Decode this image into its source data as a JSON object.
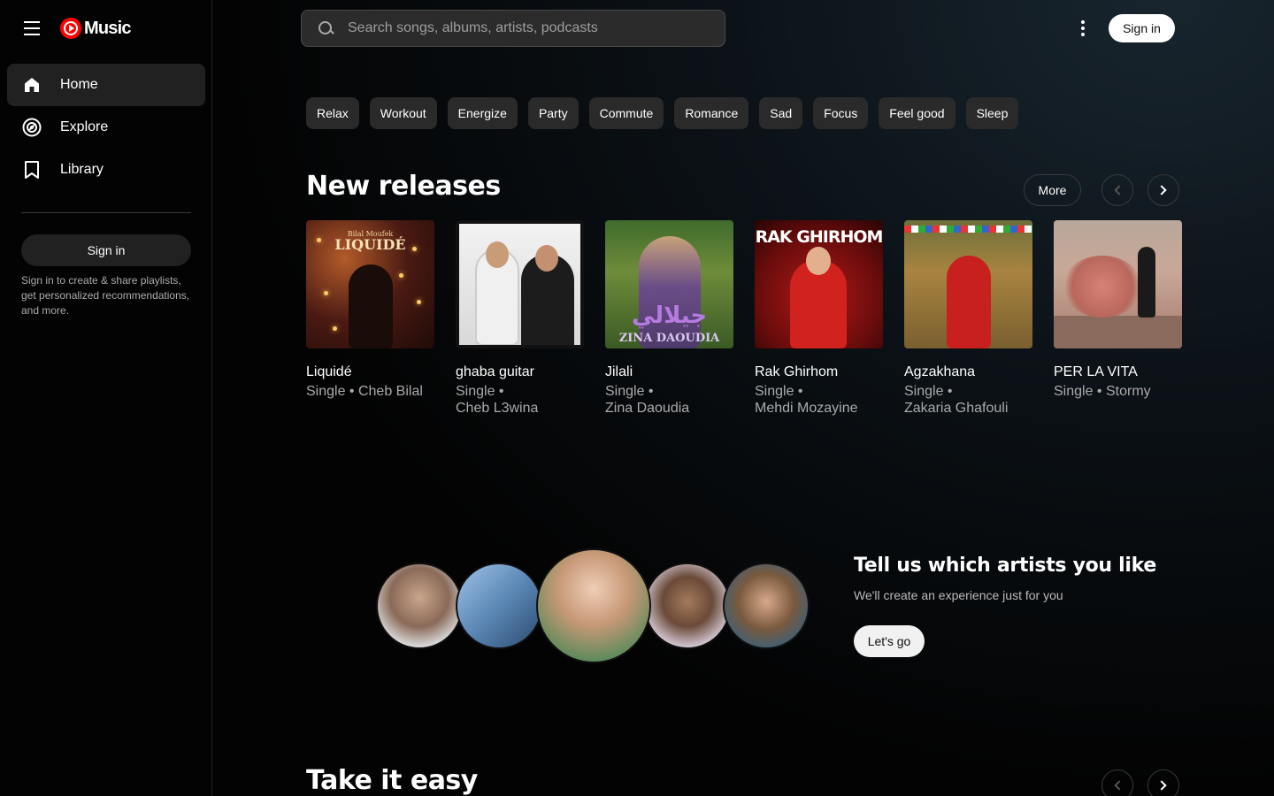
{
  "app": {
    "logo_text": "Music"
  },
  "sidebar": {
    "items": [
      {
        "label": "Home",
        "icon": "home-icon",
        "active": true
      },
      {
        "label": "Explore",
        "icon": "explore-icon",
        "active": false
      },
      {
        "label": "Library",
        "icon": "library-icon",
        "active": false
      }
    ],
    "signin_label": "Sign in",
    "note": "Sign in to create & share playlists, get personalized recommendations, and more."
  },
  "header": {
    "search_placeholder": "Search songs, albums, artists, podcasts",
    "signin_label": "Sign in"
  },
  "chips": [
    "Relax",
    "Workout",
    "Energize",
    "Party",
    "Commute",
    "Romance",
    "Sad",
    "Focus",
    "Feel good",
    "Sleep"
  ],
  "new_releases": {
    "title": "New releases",
    "more_label": "More",
    "items": [
      {
        "title": "Liquidé",
        "subtitle": "Single • Cheb Bilal",
        "art_text": "LIQUIDÉ",
        "art_small": "Bilal Moufek"
      },
      {
        "title": "ghaba guitar",
        "subtitle_line1": "Single •",
        "subtitle_line2": "Cheb L3wina"
      },
      {
        "title": "Jilali",
        "subtitle_line1": "Single •",
        "subtitle_line2": "Zina Daoudia",
        "art_text": "ZINA DAOUDIA"
      },
      {
        "title": "Rak Ghirhom",
        "subtitle_line1": "Single •",
        "subtitle_line2": "Mehdi Mozayine",
        "art_text": "RAK GHIRHOM"
      },
      {
        "title": "Agzakhana",
        "subtitle_line1": "Single •",
        "subtitle_line2": "Zakaria Ghafouli"
      },
      {
        "title": "PER LA VITA",
        "subtitle": "Single • Stormy"
      }
    ]
  },
  "promo": {
    "title": "Tell us which artists you like",
    "subtitle": "We'll create an experience just for you",
    "button_label": "Let's go"
  },
  "take_it_easy": {
    "title": "Take it easy"
  },
  "colors": {
    "background": "#030303",
    "accent": "#ff0000",
    "chip": "#2a2a2a"
  }
}
